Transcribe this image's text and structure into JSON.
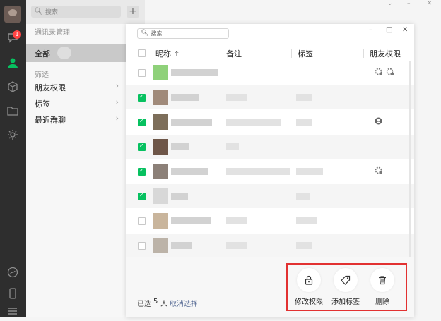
{
  "rail": {
    "badge": "1",
    "icons": [
      "chat-icon",
      "contacts-icon",
      "favorites-icon",
      "files-icon",
      "settings-gear-icon",
      "mini-program-icon",
      "phone-icon",
      "menu-icon"
    ]
  },
  "main_search": {
    "placeholder": "搜索"
  },
  "contacts_panel": {
    "title": "通讯录管理",
    "all_label": "全部",
    "filter_title": "筛选",
    "items": [
      {
        "label": "朋友权限"
      },
      {
        "label": "标签"
      },
      {
        "label": "最近群聊"
      }
    ]
  },
  "dialog": {
    "search_placeholder": "搜索",
    "controls": {
      "minimize": "–",
      "maximize": "□",
      "close": "✕"
    },
    "columns": {
      "nickname": "昵称 ↑",
      "remark": "备注",
      "tag": "标签",
      "permission": "朋友权限"
    },
    "rows": [
      {
        "checked": false,
        "avatar": "#8fd17a",
        "perm_icons": [
          "privacy-lock-icon",
          "moments-blocked-icon"
        ]
      },
      {
        "checked": true,
        "avatar": "#a08a7a",
        "perm_icons": []
      },
      {
        "checked": true,
        "avatar": "#7d6e5a",
        "perm_icons": [
          "user-icon"
        ]
      },
      {
        "checked": true,
        "avatar": "#6e5648",
        "perm_icons": []
      },
      {
        "checked": true,
        "avatar": "#8c8078",
        "perm_icons": [
          "moments-blocked-icon"
        ]
      },
      {
        "checked": true,
        "avatar": "#d8d8d8",
        "perm_icons": []
      },
      {
        "checked": false,
        "avatar": "#c9b59c",
        "perm_icons": []
      },
      {
        "checked": false,
        "avatar": "#bcb3a8",
        "perm_icons": []
      }
    ],
    "footer": {
      "selected_label": "已选",
      "selected_count": "5",
      "selected_unit": "人",
      "cancel_label": "取消选择",
      "actions": [
        {
          "label": "修改权限",
          "icon": "lock-icon"
        },
        {
          "label": "添加标签",
          "icon": "tag-icon"
        },
        {
          "label": "删除",
          "icon": "trash-icon"
        }
      ]
    }
  },
  "colors": {
    "accent": "#07c160",
    "highlight": "#e23131",
    "link": "#576b95"
  }
}
